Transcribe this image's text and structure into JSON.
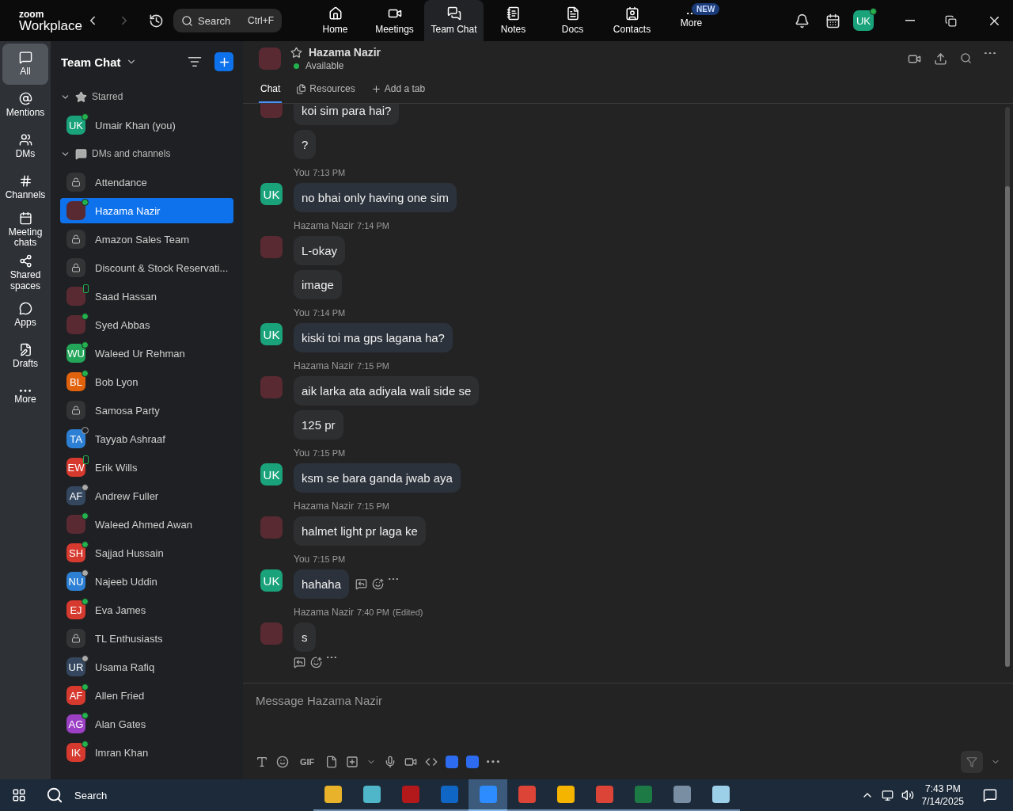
{
  "top_bar": {
    "logo_small": "zoom",
    "logo_large": "Workplace",
    "search": {
      "placeholder": "Search",
      "shortcut": "Ctrl+F"
    },
    "nav": [
      {
        "label": "Home",
        "selected": false
      },
      {
        "label": "Meetings",
        "selected": false
      },
      {
        "label": "Team Chat",
        "selected": true
      },
      {
        "label": "Notes",
        "selected": false
      },
      {
        "label": "Docs",
        "selected": false
      },
      {
        "label": "Contacts",
        "selected": false
      },
      {
        "label": "More",
        "selected": false,
        "badge": "NEW"
      }
    ],
    "avatar": "UK"
  },
  "rail": [
    {
      "label": "All",
      "selected": true
    },
    {
      "label": "Mentions",
      "selected": false
    },
    {
      "label": "DMs",
      "selected": false
    },
    {
      "label": "Channels",
      "selected": false
    },
    {
      "label": "Meeting chats",
      "selected": false
    },
    {
      "label": "Shared spaces",
      "selected": false
    },
    {
      "label": "Apps",
      "selected": false
    },
    {
      "label": "Drafts",
      "selected": false
    },
    {
      "label": "More",
      "selected": false
    }
  ],
  "sidebar": {
    "title": "Team Chat",
    "sections": [
      {
        "label": "Starred",
        "expanded": true,
        "items": [
          {
            "name": "Umair Khan (you)",
            "kind": "initials",
            "initials": "UK",
            "color": "#1aa37a",
            "online": true,
            "mobile": false,
            "away": false,
            "selected": false
          }
        ]
      },
      {
        "label": "DMs and channels",
        "expanded": true,
        "items": [
          {
            "name": "Attendance",
            "kind": "channel",
            "selected": false
          },
          {
            "name": "Hazama Nazir",
            "kind": "photo",
            "online": true,
            "mobile": false,
            "away": false,
            "selected": true
          },
          {
            "name": "Amazon Sales Team",
            "kind": "channel",
            "selected": false
          },
          {
            "name": "Discount & Stock Reservati...",
            "kind": "channel",
            "selected": false
          },
          {
            "name": "Saad Hassan",
            "kind": "photo",
            "online": true,
            "mobile": true,
            "away": false,
            "selected": false
          },
          {
            "name": "Syed Abbas",
            "kind": "photo",
            "online": true,
            "mobile": false,
            "away": false,
            "selected": false
          },
          {
            "name": "Waleed Ur Rehman",
            "kind": "initials",
            "initials": "WU",
            "color": "#23a55a",
            "online": true,
            "mobile": false,
            "away": false,
            "selected": false
          },
          {
            "name": "Bob Lyon",
            "kind": "initials",
            "initials": "BL",
            "color": "#e0620d",
            "online": true,
            "mobile": false,
            "away": false,
            "selected": false
          },
          {
            "name": "Samosa Party",
            "kind": "channel",
            "selected": false
          },
          {
            "name": "Tayyab Ashraaf",
            "kind": "initials",
            "initials": "TA",
            "color": "#2d7fd3",
            "online": false,
            "mobile": false,
            "away": false,
            "selected": false
          },
          {
            "name": "Erik Wills",
            "kind": "initials",
            "initials": "EW",
            "color": "#d63a2f",
            "online": true,
            "mobile": true,
            "away": false,
            "selected": false
          },
          {
            "name": "Andrew Fuller",
            "kind": "initials",
            "initials": "AF",
            "color": "#34475e",
            "online": false,
            "mobile": false,
            "away": true,
            "selected": false
          },
          {
            "name": "Waleed Ahmed Awan",
            "kind": "photo",
            "online": true,
            "mobile": false,
            "away": false,
            "selected": false
          },
          {
            "name": "Sajjad Hussain",
            "kind": "initials",
            "initials": "SH",
            "color": "#d63a2f",
            "online": true,
            "mobile": false,
            "away": false,
            "selected": false
          },
          {
            "name": "Najeeb Uddin",
            "kind": "initials",
            "initials": "NU",
            "color": "#2d7fd3",
            "online": false,
            "mobile": false,
            "away": true,
            "selected": false
          },
          {
            "name": "Eva James",
            "kind": "initials",
            "initials": "EJ",
            "color": "#d63a2f",
            "online": true,
            "mobile": false,
            "away": false,
            "selected": false
          },
          {
            "name": "TL Enthusiasts",
            "kind": "channel",
            "selected": false
          },
          {
            "name": "Usama Rafiq",
            "kind": "initials",
            "initials": "UR",
            "color": "#34475e",
            "online": false,
            "mobile": false,
            "away": true,
            "selected": false
          },
          {
            "name": "Allen Fried",
            "kind": "initials",
            "initials": "AF",
            "color": "#d63a2f",
            "online": true,
            "mobile": false,
            "away": false,
            "selected": false
          },
          {
            "name": "Alan Gates",
            "kind": "initials",
            "initials": "AG",
            "color": "#9b3fc4",
            "online": true,
            "mobile": false,
            "away": false,
            "selected": false
          },
          {
            "name": "Imran Khan",
            "kind": "initials",
            "initials": "IK",
            "color": "#d63a2f",
            "online": true,
            "mobile": false,
            "away": false,
            "selected": false
          }
        ]
      }
    ]
  },
  "chat": {
    "name": "Hazama Nazir",
    "status": "Available",
    "tabs": [
      {
        "label": "Chat",
        "selected": true
      },
      {
        "label": "Resources",
        "selected": false
      },
      {
        "label": "Add a tab",
        "selected": false
      }
    ],
    "groups": [
      {
        "self": false,
        "messages": [
          {
            "text": "koi sim para hai?",
            "hovered": false
          },
          {
            "text": "?",
            "hovered": false
          }
        ]
      },
      {
        "self": true,
        "avatar": "UK",
        "sender": "You",
        "time": "7:13 PM",
        "messages": [
          {
            "text": "no bhai only having one sim",
            "hovered": false
          }
        ]
      },
      {
        "self": false,
        "sender": "Hazama Nazir",
        "time": "7:14 PM",
        "messages": [
          {
            "text": "L-okay",
            "hovered": false
          },
          {
            "text": "image",
            "hovered": false
          }
        ]
      },
      {
        "self": true,
        "avatar": "UK",
        "sender": "You",
        "time": "7:14 PM",
        "messages": [
          {
            "text": "kiski toi ma gps lagana ha?",
            "hovered": false
          }
        ]
      },
      {
        "self": false,
        "sender": "Hazama Nazir",
        "time": "7:15 PM",
        "messages": [
          {
            "text": "aik larka ata adiyala wali side se",
            "hovered": false
          },
          {
            "text": "125 pr",
            "hovered": false
          }
        ]
      },
      {
        "self": true,
        "avatar": "UK",
        "sender": "You",
        "time": "7:15 PM",
        "messages": [
          {
            "text": "ksm se bara ganda jwab aya",
            "hovered": false
          }
        ]
      },
      {
        "self": false,
        "sender": "Hazama Nazir",
        "time": "7:15 PM",
        "messages": [
          {
            "text": "halmet light pr laga ke",
            "hovered": false
          }
        ]
      },
      {
        "self": true,
        "avatar": "UK",
        "sender": "You",
        "time": "7:15 PM",
        "messages": [
          {
            "text": "hahaha",
            "hovered": true
          }
        ]
      },
      {
        "self": false,
        "sender": "Hazama Nazir",
        "time": "7:40 PM",
        "edited": "(Edited)",
        "messages": [
          {
            "text": "s",
            "hovered": true
          }
        ]
      }
    ],
    "composer": {
      "placeholder": "Message Hazama Nazir",
      "gif": "GIF"
    }
  },
  "taskbar": {
    "search": "Search",
    "time": "7:43 PM",
    "date": "7/14/2025"
  }
}
